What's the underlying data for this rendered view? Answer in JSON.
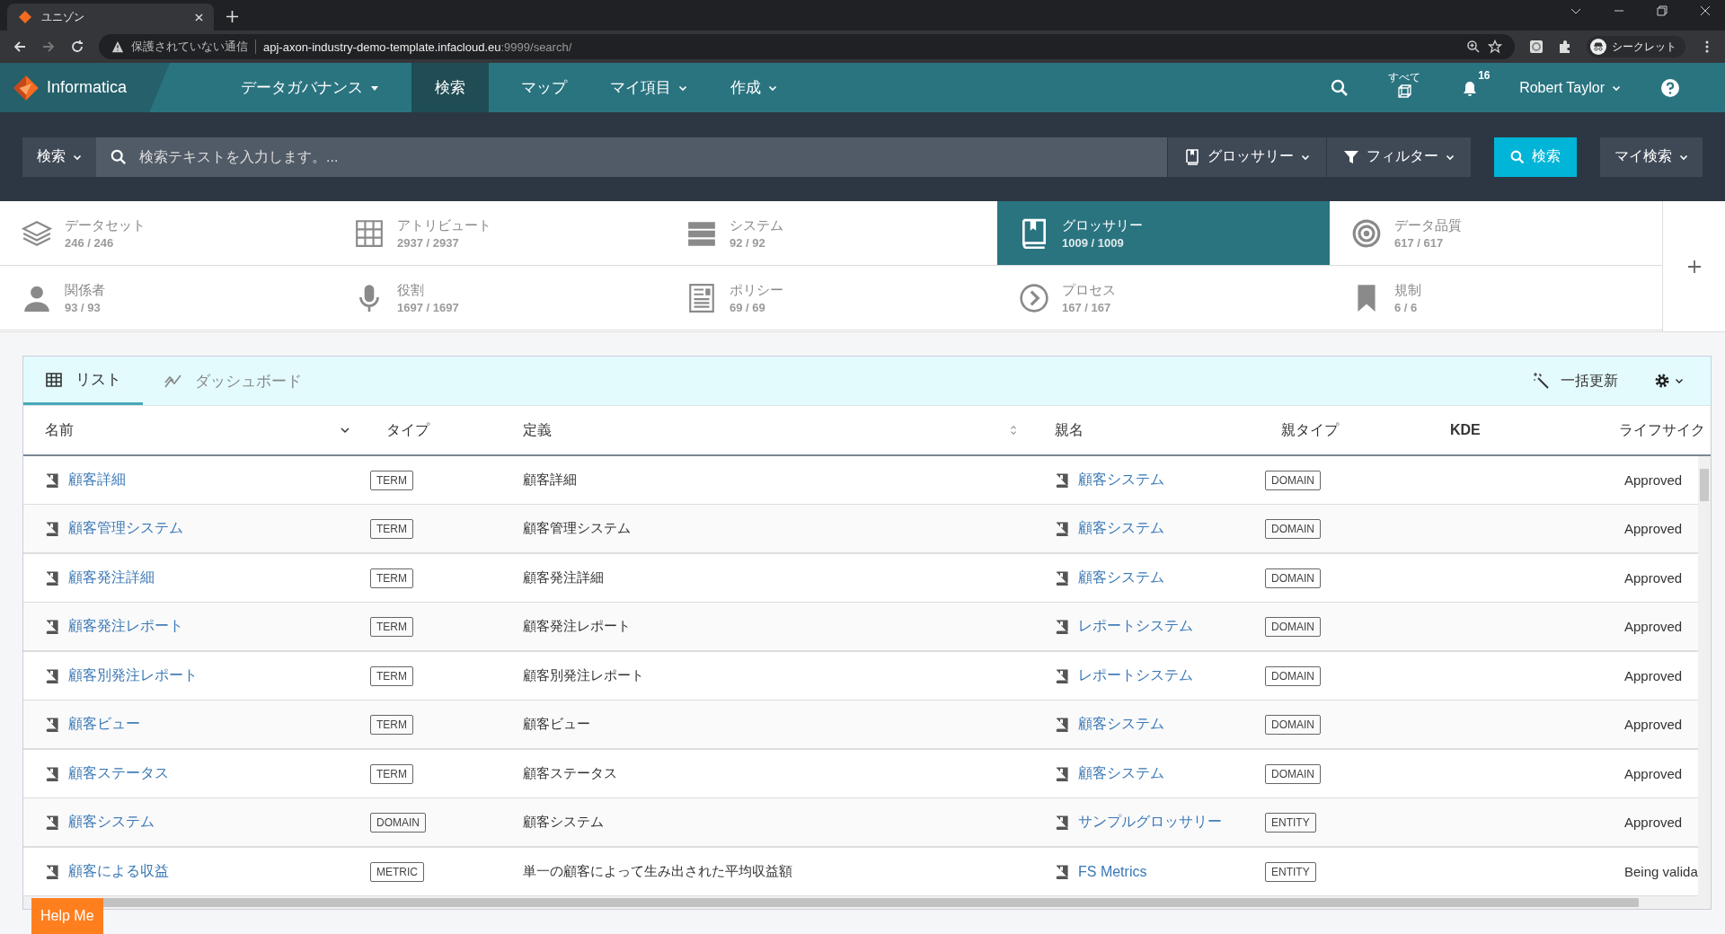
{
  "browser": {
    "tab_title": "ユニゾン",
    "url_warning": "保護されていない通信",
    "url_host": "apj-axon-industry-demo-template.infacloud.eu",
    "url_rest": ":9999/search/",
    "profile": "シークレット"
  },
  "nav": {
    "brand": "Informatica",
    "items": [
      {
        "label": "データガバナンス",
        "selected": false,
        "kind": "caret"
      },
      {
        "label": "検索",
        "selected": true,
        "kind": "plain"
      },
      {
        "label": "マップ",
        "selected": false,
        "kind": "plain"
      },
      {
        "label": "マイ項目",
        "selected": false,
        "kind": "chevron"
      },
      {
        "label": "作成",
        "selected": false,
        "kind": "chevron"
      }
    ],
    "all_label": "すべて",
    "notifications": "16",
    "user": "Robert Taylor"
  },
  "search": {
    "scope": "検索",
    "placeholder": "検索テキストを入力します。...",
    "glossary": "グロッサリー",
    "filter": "フィルター",
    "button": "検索",
    "my_search": "マイ検索"
  },
  "categories": [
    {
      "label": "データセット",
      "count": "246 / 246",
      "selected": false
    },
    {
      "label": "アトリビュート",
      "count": "2937 / 2937",
      "selected": false
    },
    {
      "label": "システム",
      "count": "92 / 92",
      "selected": false
    },
    {
      "label": "グロッサリー",
      "count": "1009 / 1009",
      "selected": true
    },
    {
      "label": "データ品質",
      "count": "617 / 617",
      "selected": false
    },
    {
      "label": "関係者",
      "count": "93 / 93",
      "selected": false
    },
    {
      "label": "役割",
      "count": "1697 / 1697",
      "selected": false
    },
    {
      "label": "ポリシー",
      "count": "69 / 69",
      "selected": false
    },
    {
      "label": "プロセス",
      "count": "167 / 167",
      "selected": false
    },
    {
      "label": "規制",
      "count": "6 / 6",
      "selected": false
    }
  ],
  "view_tabs": [
    {
      "label": "リスト",
      "selected": true
    },
    {
      "label": "ダッシュボード",
      "selected": false
    }
  ],
  "bulk_update": "一括更新",
  "table": {
    "columns": [
      "名前",
      "タイプ",
      "定義",
      "親名",
      "親タイプ",
      "KDE",
      "ライフサイク"
    ],
    "rows": [
      {
        "name": "顧客詳細",
        "type": "TERM",
        "definition": "顧客詳細",
        "parent_name": "顧客システム",
        "parent_type": "DOMAIN",
        "lifecycle": "Approved"
      },
      {
        "name": "顧客管理システム",
        "type": "TERM",
        "definition": "顧客管理システム",
        "parent_name": "顧客システム",
        "parent_type": "DOMAIN",
        "lifecycle": "Approved"
      },
      {
        "name": "顧客発注詳細",
        "type": "TERM",
        "definition": "顧客発注詳細",
        "parent_name": "顧客システム",
        "parent_type": "DOMAIN",
        "lifecycle": "Approved"
      },
      {
        "name": "顧客発注レポート",
        "type": "TERM",
        "definition": "顧客発注レポート",
        "parent_name": "レポートシステム",
        "parent_type": "DOMAIN",
        "lifecycle": "Approved"
      },
      {
        "name": "顧客別発注レポート",
        "type": "TERM",
        "definition": "顧客別発注レポート",
        "parent_name": "レポートシステム",
        "parent_type": "DOMAIN",
        "lifecycle": "Approved"
      },
      {
        "name": "顧客ビュー",
        "type": "TERM",
        "definition": "顧客ビュー",
        "parent_name": "顧客システム",
        "parent_type": "DOMAIN",
        "lifecycle": "Approved"
      },
      {
        "name": "顧客ステータス",
        "type": "TERM",
        "definition": "顧客ステータス",
        "parent_name": "顧客システム",
        "parent_type": "DOMAIN",
        "lifecycle": "Approved"
      },
      {
        "name": "顧客システム",
        "type": "DOMAIN",
        "definition": "顧客システム",
        "parent_name": "サンプルグロッサリー",
        "parent_type": "ENTITY",
        "lifecycle": "Approved"
      },
      {
        "name": "顧客による収益",
        "type": "METRIC",
        "definition": "単一の顧客によって生み出された平均収益額",
        "parent_name": "FS Metrics",
        "parent_type": "ENTITY",
        "lifecycle": "Being valida"
      }
    ]
  },
  "help_button": "Help Me"
}
